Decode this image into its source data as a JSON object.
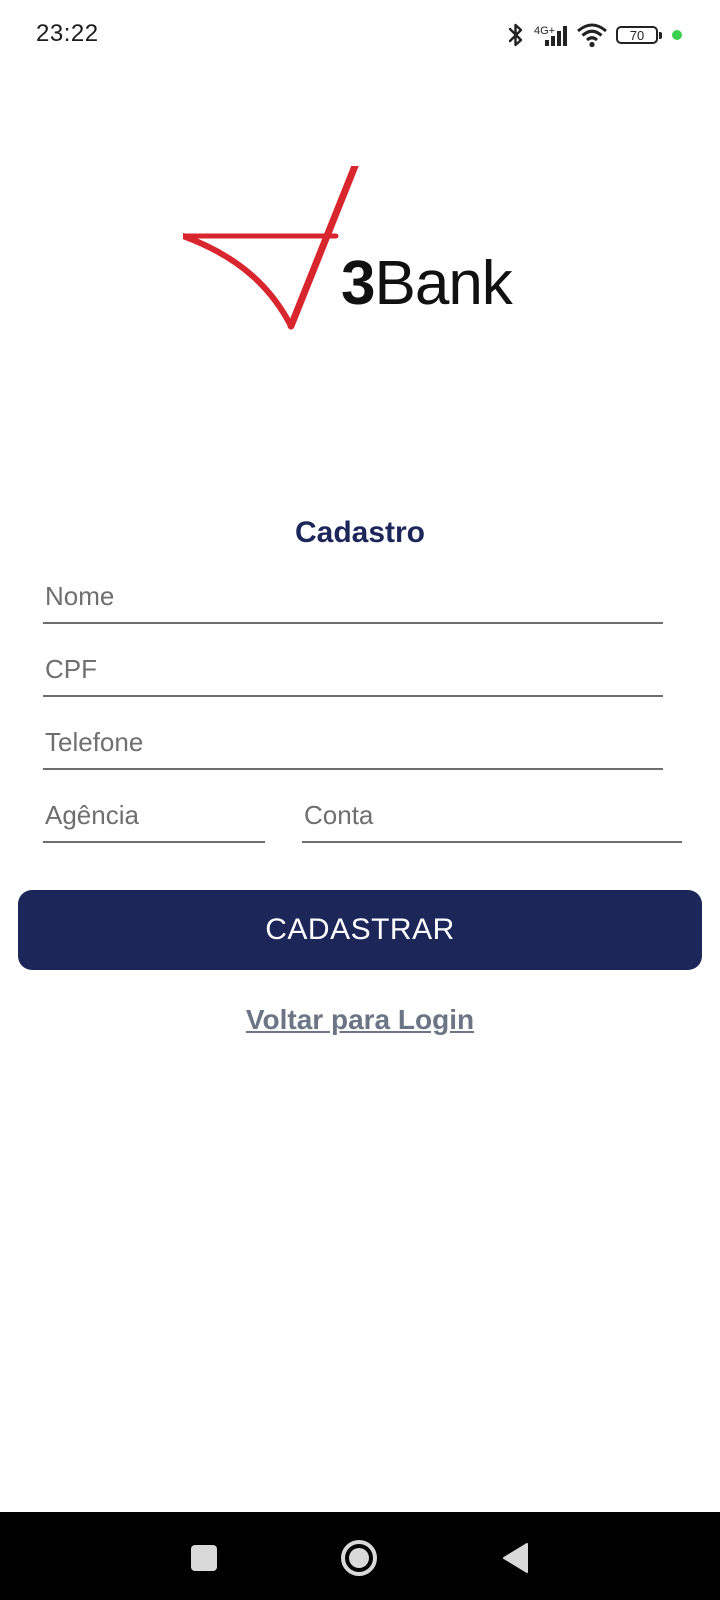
{
  "status_bar": {
    "time": "23:22",
    "network": "4G+",
    "battery": "70",
    "icons": [
      "bluetooth-icon",
      "signal-icon",
      "wifi-icon",
      "battery-icon",
      "privacy-dot-icon"
    ],
    "dot_color": "#3ccf4e"
  },
  "logo": {
    "number": "3",
    "name": "Bank",
    "mark_color": "#d9262e"
  },
  "form": {
    "title": "Cadastro",
    "name_placeholder": "Nome",
    "cpf_placeholder": "CPF",
    "phone_placeholder": "Telefone",
    "agency_placeholder": "Agência",
    "account_placeholder": "Conta",
    "submit_label": "CADASTRAR",
    "back_link": "Voltar para Login"
  },
  "colors": {
    "primary": "#1c2659",
    "title": "#1c2659",
    "link": "#6b7585",
    "underline": "#6e6e6e"
  },
  "nav_bar": {
    "icons": [
      "recent-apps-icon",
      "home-icon",
      "back-icon"
    ]
  }
}
